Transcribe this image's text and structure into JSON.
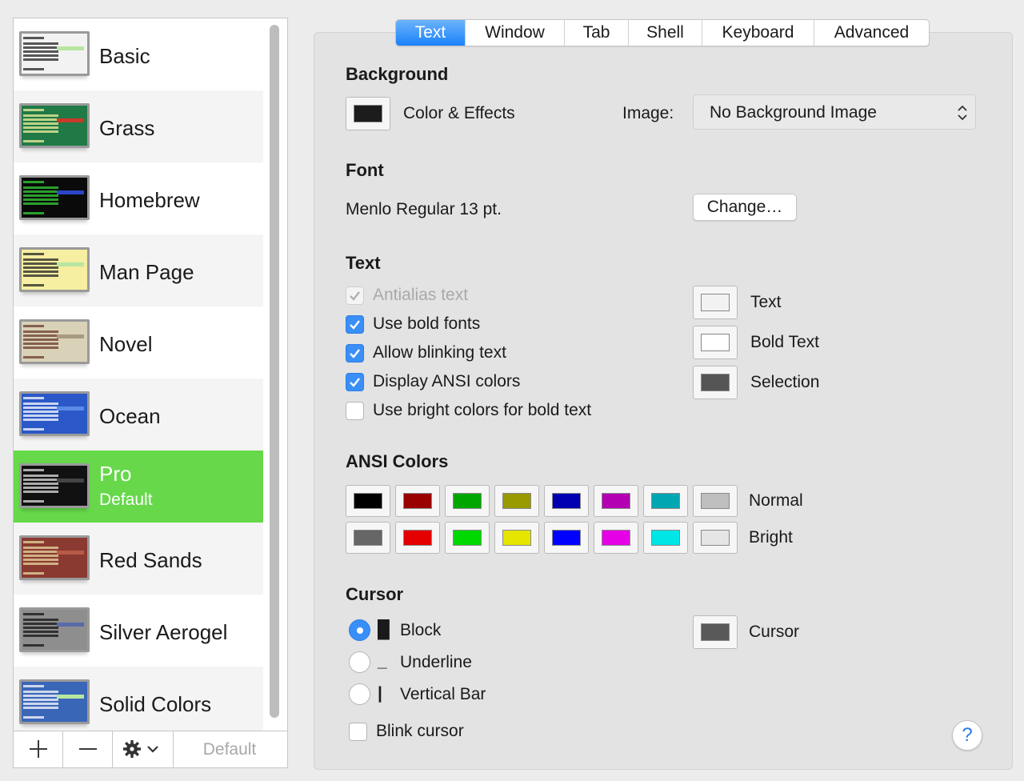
{
  "profiles": [
    {
      "name": "Basic",
      "thumb_bg": "#f2f2f2",
      "thumb_text": "#222222",
      "thumb_hl": "#b8e6a0"
    },
    {
      "name": "Grass",
      "thumb_bg": "#1f7a45",
      "thumb_text": "#f3f0a0",
      "thumb_hl": "#c83a2a"
    },
    {
      "name": "Homebrew",
      "thumb_bg": "#0a0a0a",
      "thumb_text": "#36d23a",
      "thumb_hl": "#2a46c8"
    },
    {
      "name": "Man Page",
      "thumb_bg": "#f6eea0",
      "thumb_text": "#222222",
      "thumb_hl": "#b8e6a0"
    },
    {
      "name": "Novel",
      "thumb_bg": "#d9d2b8",
      "thumb_text": "#6a3a2a",
      "thumb_hl": "#a89a80"
    },
    {
      "name": "Ocean",
      "thumb_bg": "#2b58c8",
      "thumb_text": "#ffffff",
      "thumb_hl": "#5a8ae8"
    },
    {
      "name": "Pro",
      "subtitle": "Default",
      "thumb_bg": "#111111",
      "thumb_text": "#e0e0e0",
      "thumb_hl": "#444444"
    },
    {
      "name": "Red Sands",
      "thumb_bg": "#8a3a30",
      "thumb_text": "#e8d8a0",
      "thumb_hl": "#b85a48"
    },
    {
      "name": "Silver Aerogel",
      "thumb_bg": "#8e8e8e",
      "thumb_text": "#111111",
      "thumb_hl": "#5a6aa8"
    },
    {
      "name": "Solid Colors",
      "thumb_bg": "#3a66b8",
      "thumb_text": "#ffffff",
      "thumb_hl": "#b8e6a0"
    }
  ],
  "sidebar_toolbar": {
    "add_icon": "plus-icon",
    "remove_icon": "minus-icon",
    "action_icon": "gear-icon",
    "default_label": "Default"
  },
  "tabs": [
    "Text",
    "Window",
    "Tab",
    "Shell",
    "Keyboard",
    "Advanced"
  ],
  "active_tab": "Text",
  "background": {
    "title": "Background",
    "color_effects_label": "Color & Effects",
    "color": "#1c1c1c",
    "image_label": "Image:",
    "image_value": "No Background Image"
  },
  "font": {
    "title": "Font",
    "value": "Menlo Regular 13 pt.",
    "change_label": "Change…"
  },
  "text": {
    "title": "Text",
    "options": [
      {
        "label": "Antialias text",
        "checked": true,
        "disabled": true
      },
      {
        "label": "Use bold fonts",
        "checked": true,
        "disabled": false
      },
      {
        "label": "Allow blinking text",
        "checked": true,
        "disabled": false
      },
      {
        "label": "Display ANSI colors",
        "checked": true,
        "disabled": false
      },
      {
        "label": "Use bright colors for bold text",
        "checked": false,
        "disabled": false
      }
    ],
    "colors": [
      {
        "label": "Text",
        "color": "#f2f2f2"
      },
      {
        "label": "Bold Text",
        "color": "#ffffff"
      },
      {
        "label": "Selection",
        "color": "#555555"
      }
    ]
  },
  "ansi": {
    "title": "ANSI Colors",
    "normal_label": "Normal",
    "bright_label": "Bright",
    "normal": [
      "#000000",
      "#990000",
      "#00a600",
      "#999900",
      "#0000b2",
      "#b200b2",
      "#00a6b2",
      "#bfbfbf"
    ],
    "bright": [
      "#666666",
      "#e50000",
      "#00d900",
      "#e5e500",
      "#0000ff",
      "#e500e5",
      "#00e5e5",
      "#e5e5e5"
    ]
  },
  "cursor": {
    "title": "Cursor",
    "options": [
      {
        "glyph": "█",
        "label": "Block",
        "selected": true
      },
      {
        "glyph": "_",
        "label": "Underline",
        "selected": false
      },
      {
        "glyph": "|",
        "label": "Vertical Bar",
        "selected": false
      }
    ],
    "blink_label": "Blink cursor",
    "blink_checked": false,
    "color_label": "Cursor",
    "color": "#595959"
  },
  "help_label": "?"
}
